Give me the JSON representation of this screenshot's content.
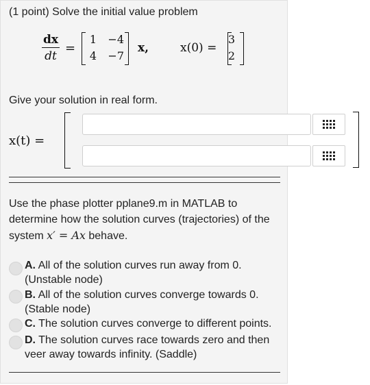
{
  "header": {
    "points": "(1 point)",
    "instruction": "Solve the initial value problem"
  },
  "equation": {
    "lhs_num": "dx",
    "lhs_den": "dt",
    "matrix": [
      [
        "1",
        "−4"
      ],
      [
        "4",
        "−7"
      ]
    ],
    "times_var": "x,",
    "ic_label": "x(0) =",
    "ic_vector": [
      "3",
      "2"
    ]
  },
  "prompt": "Give your solution in real form.",
  "solution": {
    "label": "x(t) =",
    "input1_value": "",
    "input2_value": ""
  },
  "question": {
    "text_before": "Use the phase plotter pplane9.m in MATLAB to determine how the solution curves (trajectories) of the system ",
    "system": "x′ = Ax",
    "text_after": " behave."
  },
  "options": [
    {
      "letter": "A.",
      "text": "All of the solution curves run away from 0. (Unstable node)"
    },
    {
      "letter": "B.",
      "text": "All of the solution curves converge towards 0. (Stable node)"
    },
    {
      "letter": "C.",
      "text": "The solution curves converge to different points."
    },
    {
      "letter": "D.",
      "text": "The solution curves race towards zero and then veer away towards infinity. (Saddle)"
    }
  ]
}
